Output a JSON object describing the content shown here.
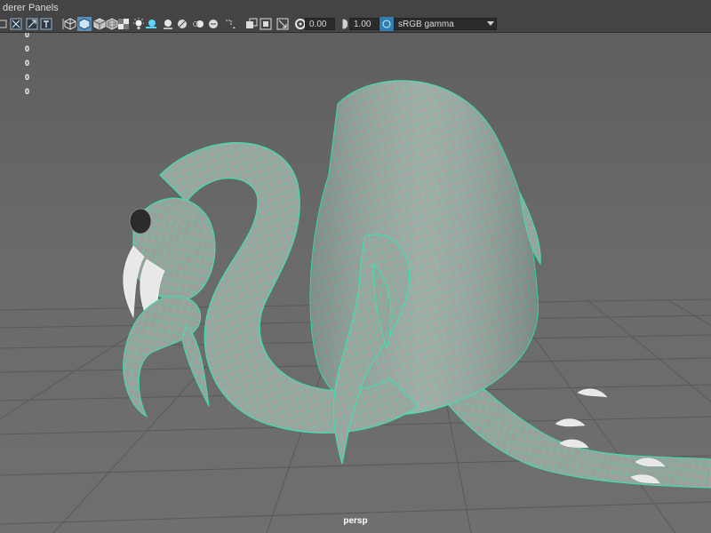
{
  "menu": {
    "items": [
      {
        "label": "derer"
      },
      {
        "label": "Panels"
      }
    ]
  },
  "toolbar": {
    "icons": [
      "camera-attributes-icon",
      "bookmark-icon",
      "image-plane-icon",
      "2d-pan-zoom-icon",
      "grease-pencil-icon",
      "wireframe-icon",
      "smooth-shade-icon",
      "wireframe-on-shaded-icon",
      "textured-icon",
      "use-all-lights-icon",
      "shadows-icon",
      "screen-space-ambient-occlusion-icon",
      "motion-blur-icon",
      "multisample-antialiasing-icon",
      "depth-of-field-icon",
      "isolate-select-icon",
      "xray-icon",
      "xray-active-components-icon",
      "xray-joints-icon",
      "backface-culling-icon",
      "exposure-icon",
      "gamma-icon",
      "color-management-icon"
    ],
    "exposure_value": "0.00",
    "gamma_value": "1.00",
    "color_space": "sRGB gamma"
  },
  "hud": {
    "counts": [
      "0",
      "0",
      "0",
      "0",
      "0"
    ]
  },
  "viewport": {
    "camera_label": "persp",
    "background_color": "#6a6a6a",
    "grid_color": "#555555",
    "wireframe_color": "#3fe0b0",
    "mesh_color": "#9aa09a"
  }
}
